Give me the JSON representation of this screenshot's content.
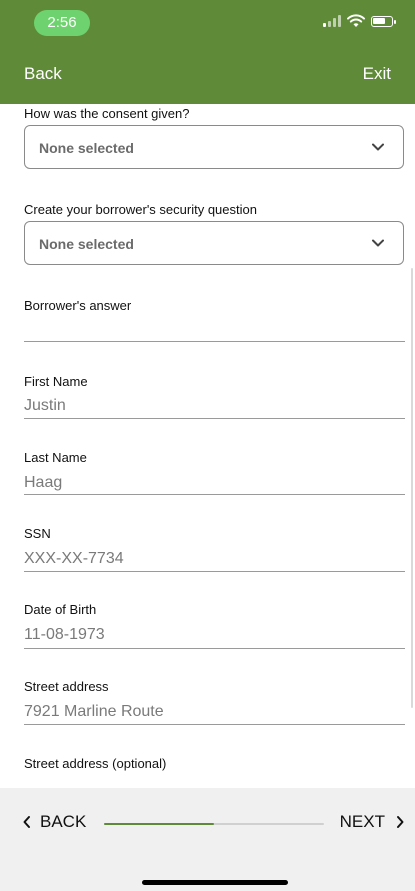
{
  "status": {
    "time": "2:56"
  },
  "nav": {
    "back": "Back",
    "exit": "Exit"
  },
  "form": {
    "consent": {
      "label": "How was the consent given?",
      "value": "None selected"
    },
    "security_question": {
      "label": "Create your borrower's security question",
      "value": "None selected"
    },
    "answer": {
      "label": "Borrower's answer",
      "value": ""
    },
    "first_name": {
      "label": "First Name",
      "value": "Justin"
    },
    "last_name": {
      "label": "Last Name",
      "value": "Haag"
    },
    "ssn": {
      "label": "SSN",
      "value": "XXX-XX-7734"
    },
    "dob": {
      "label": "Date of Birth",
      "value": "11-08-1973"
    },
    "street": {
      "label": "Street address",
      "value": "7921 Marline Route"
    },
    "street2": {
      "label": "Street address (optional)",
      "value": ""
    }
  },
  "bottom": {
    "back": "BACK",
    "next": "NEXT",
    "progress": 0.5
  },
  "colors": {
    "header": "#5f8b38",
    "accent": "#5f8b38",
    "time_pill": "#6ed36e"
  },
  "icons": {
    "chevron": "chevron-down-icon",
    "back": "chevron-left-icon",
    "next": "chevron-right-icon"
  }
}
